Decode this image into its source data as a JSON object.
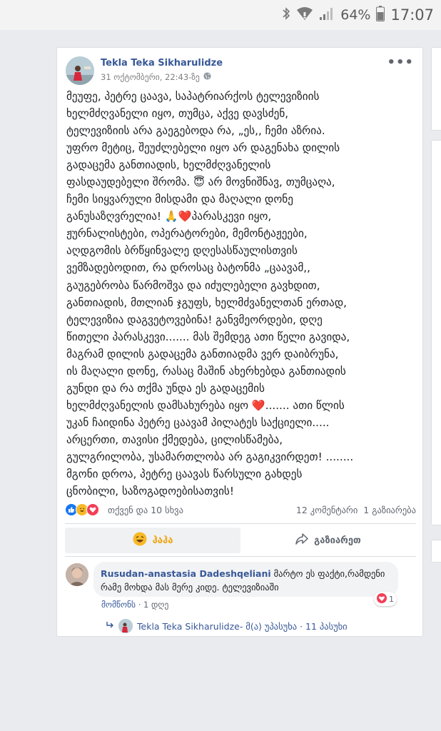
{
  "status_bar": {
    "battery": "64%",
    "time": "17:07"
  },
  "post": {
    "author": "Tekla Teka Sikharulidze",
    "timestamp": "31 ოქტომბერი, 22:43-ზე",
    "text_lines": [
      "მეუფე, პეტრე ცაავა, საპატრიარქოს ტელევიზიის",
      "ხელმძღვანელი იყო, თუმცა, აქვე დავსძენ,",
      "ტელევიზიის არა გაეგებოდა რა, „ეს,, ჩემი აზრია.",
      "უფრო მეტიც, შეუძლებელი იყო არ დაგენახა დილის",
      "გადაცემა განთიადის, ხელმძღვანელის",
      "ფასდაუდებელი შრომა. 😇 არ მოვნიშნავ, თუმცაღა,",
      "ჩემი სიყვარული მისდამი და მაღალი დონე",
      "განუსაზღვრელია! 🙏❤️პარასკევი იყო,",
      "ჟურნალისტები, ოპერატორები, მემონტაჟეები,",
      "აღდგომის ბრწყინვალე დღესასწაულისთვის",
      "ვემზადებოდით, რა დროსაც ბატონმა „ცაავამ,,",
      "გაუგებრობა წარმოშვა და იძულებელი გავხდით,",
      "განთიადის, მთლიან ჯგუფს, ხელმძვანელთან ერთად,",
      "ტელევიზია დაგვეტოვებინა! განვმეორდები, დღე",
      "წითელი პარასკევი....... მას შემდეგ ათი წელი გავიდა,",
      "მაგრამ დილის გადაცემა განთიადმა ვერ დაიბრუნა,",
      "ის მაღალი დონე, რასაც მაშინ ახერხებდა განთიადის",
      "გუნდი და რა თქმა უნდა ეს გადაცემის",
      "ხელმძღვანელის დამსახურება იყო ❤️....... ათი წლის",
      "უკან ჩაიდინა პეტრე ცაავამ პილატეს საქციელი.....",
      "არცერთი, თავისი ქმედება, ცილისწამება,",
      "გულგრილობა, უსამართლობა არ გაგიკვირდეთ! ........",
      "მგონი დროა, პეტრე ცაავას წარსული გახდეს",
      "ცნობილი, საზოგადოებისათვის!"
    ],
    "reactions_people": "თქვენ და 10 სხვა",
    "comments_shares": "12 კომენტარი  1 გაზიარება",
    "action_reaction_label": "ჰაჰა",
    "action_share_label": "გაზიარეთ"
  },
  "comment": {
    "author": "Rusudan-anastasia Dadeshqeliani",
    "text": "მარტო ეს ფაქტი,რამდენი რამე მოხდა მას მერე კიდე. ტელევიზიაში",
    "reaction_count": "1",
    "like_label": "მომწონს",
    "age": "1 დღე",
    "reply_text": "Tekla Teka Sikharulidze- მ(ა) უპასუხა · 11 პასუხი"
  },
  "colors": {
    "page_bg": "#e9ebee",
    "link_blue": "#385898",
    "haha_yellow": "#f7b928",
    "love_red": "#f33e58",
    "like_blue": "#1877f2"
  }
}
